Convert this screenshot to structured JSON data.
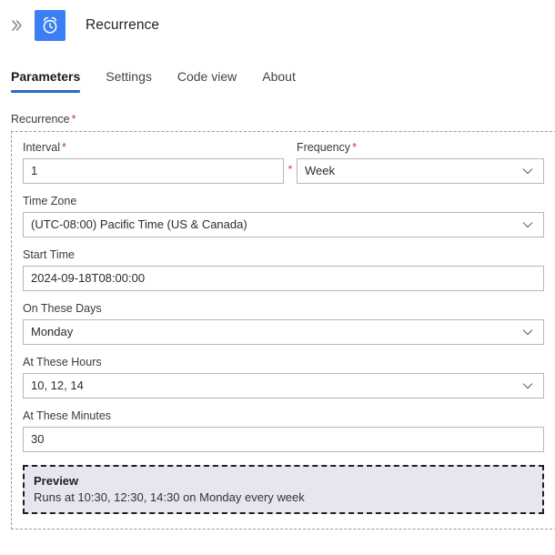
{
  "header": {
    "collapse_icon": "double-chevron-right-icon",
    "app_icon": "alarm-clock-icon",
    "title": "Recurrence"
  },
  "tabs": [
    {
      "label": "Parameters",
      "active": true
    },
    {
      "label": "Settings",
      "active": false
    },
    {
      "label": "Code view",
      "active": false
    },
    {
      "label": "About",
      "active": false
    }
  ],
  "section": {
    "label": "Recurrence",
    "required_marker": "*"
  },
  "fields": {
    "interval": {
      "label": "Interval",
      "required_marker": "*",
      "value": "1",
      "type": "text"
    },
    "between_marker": "*",
    "frequency": {
      "label": "Frequency",
      "required_marker": "*",
      "value": "Week",
      "type": "dropdown",
      "chevron": "chevron-down-icon"
    },
    "time_zone": {
      "label": "Time Zone",
      "value": "(UTC-08:00) Pacific Time (US & Canada)",
      "type": "dropdown",
      "chevron": "chevron-down-icon"
    },
    "start_time": {
      "label": "Start Time",
      "value": "2024-09-18T08:00:00",
      "type": "text"
    },
    "on_these_days": {
      "label": "On These Days",
      "value": "Monday",
      "type": "dropdown",
      "chevron": "chevron-down-icon"
    },
    "at_these_hours": {
      "label": "At These Hours",
      "value": "10, 12, 14",
      "type": "dropdown",
      "chevron": "chevron-down-icon"
    },
    "at_these_minutes": {
      "label": "At These Minutes",
      "value": "30",
      "type": "text"
    }
  },
  "preview": {
    "title": "Preview",
    "text": "Runs at 10:30, 12:30, 14:30 on Monday every week"
  },
  "colors": {
    "accent_blue": "#3c7ef3",
    "tab_underline": "#2b6cc4",
    "required_red": "#c1393d",
    "preview_bg": "#e6e6f0",
    "border_grey": "#b7b7b7"
  }
}
